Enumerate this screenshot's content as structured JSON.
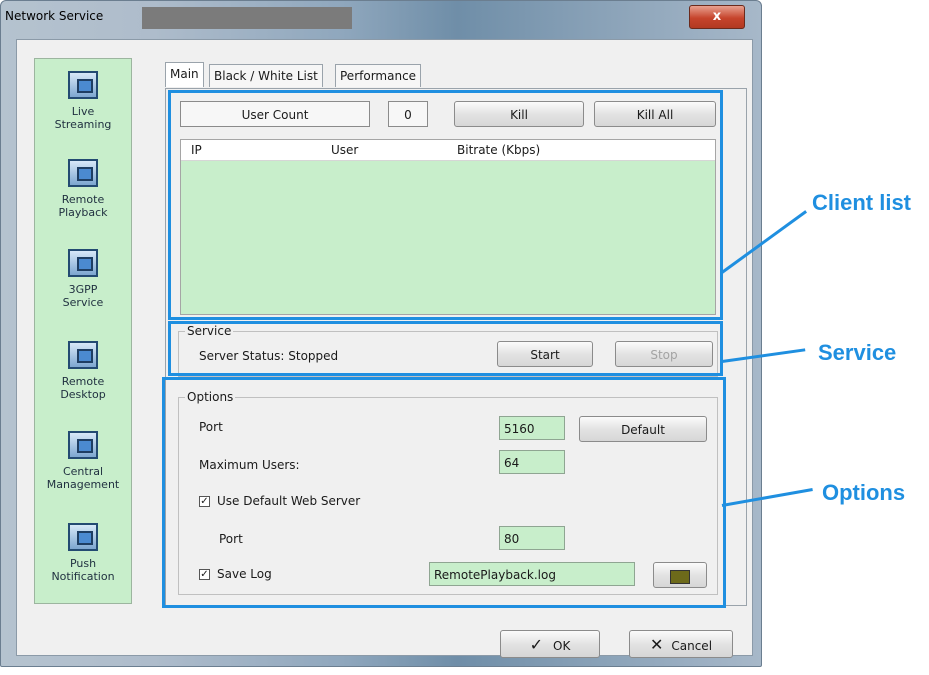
{
  "window": {
    "title": "Network Service",
    "close_label": "x"
  },
  "sidebar": {
    "items": [
      {
        "label": "Live\nStreaming",
        "icon": "monitor-icon"
      },
      {
        "label": "Remote\nPlayback",
        "icon": "playback-icon"
      },
      {
        "label": "3GPP\nService",
        "icon": "phone-icon"
      },
      {
        "label": "Remote\nDesktop",
        "icon": "remote-desktop-icon"
      },
      {
        "label": "Central\nManagement",
        "icon": "central-management-icon"
      },
      {
        "label": "Push\nNotification",
        "icon": "push-notification-icon"
      }
    ]
  },
  "tabs": [
    {
      "label": "Main",
      "active": true
    },
    {
      "label": "Black / White List",
      "active": false
    },
    {
      "label": "Performance",
      "active": false
    }
  ],
  "client_list": {
    "user_count_label": "User Count",
    "user_count_value": "0",
    "kill_label": "Kill",
    "kill_all_label": "Kill All",
    "columns": [
      "IP",
      "User",
      "Bitrate (Kbps)"
    ]
  },
  "service": {
    "group_title": "Service",
    "status_text": "Server Status: Stopped",
    "start_label": "Start",
    "stop_label": "Stop"
  },
  "options": {
    "group_title": "Options",
    "port_label": "Port",
    "port_value": "5160",
    "default_label": "Default",
    "max_users_label": "Maximum Users:",
    "max_users_value": "64",
    "use_default_web_server_label": "Use Default Web Server",
    "use_default_web_server_checked": true,
    "web_port_label": "Port",
    "web_port_value": "80",
    "save_log_label": "Save Log",
    "save_log_checked": true,
    "log_file_value": "RemotePlayback.log"
  },
  "footer": {
    "ok_label": "OK",
    "cancel_label": "Cancel"
  },
  "annotations": {
    "client_list": "Client list",
    "service": "Service",
    "options": "Options"
  },
  "colors": {
    "highlight": "#1f8fe0",
    "field_green": "#c8eecb"
  }
}
